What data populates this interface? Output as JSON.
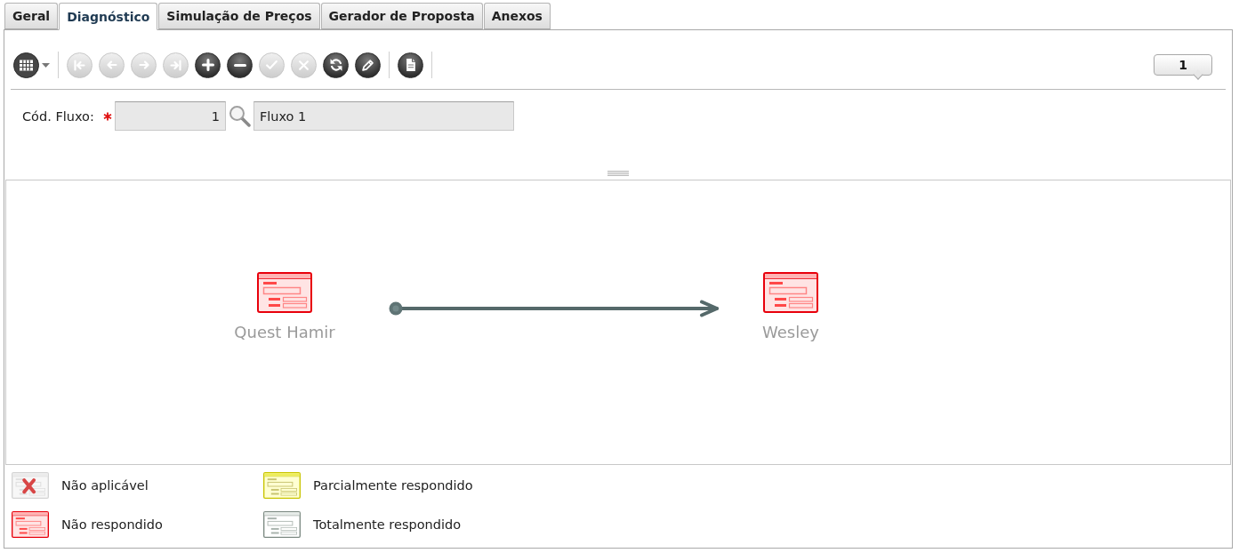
{
  "tabs": [
    {
      "label": "Geral",
      "selected": false
    },
    {
      "label": "Diagnóstico",
      "selected": true
    },
    {
      "label": "Simulação de Preços",
      "selected": false
    },
    {
      "label": "Gerador de Proposta",
      "selected": false
    },
    {
      "label": "Anexos",
      "selected": false
    }
  ],
  "toolbar": {
    "groups": [
      {
        "buttons": [
          {
            "kind": "grid_menu",
            "disabled": false
          }
        ]
      },
      {
        "buttons": [
          {
            "kind": "first",
            "disabled": true
          },
          {
            "kind": "previous",
            "disabled": true
          },
          {
            "kind": "next",
            "disabled": true
          },
          {
            "kind": "last",
            "disabled": true
          },
          {
            "kind": "add",
            "disabled": false
          },
          {
            "kind": "remove",
            "disabled": false
          },
          {
            "kind": "confirm",
            "disabled": true
          },
          {
            "kind": "cancel",
            "disabled": true
          },
          {
            "kind": "refresh",
            "disabled": false
          },
          {
            "kind": "edit",
            "disabled": false
          }
        ]
      },
      {
        "buttons": [
          {
            "kind": "report",
            "disabled": false
          }
        ]
      }
    ],
    "record_counter": "1"
  },
  "form": {
    "label": "Cód. Fluxo:",
    "required": true,
    "code": "1",
    "description": "Fluxo 1"
  },
  "diagram": {
    "nodes": [
      {
        "label": "Quest Hamir",
        "kind": "unanswered"
      },
      {
        "label": "Wesley",
        "kind": "unanswered"
      }
    ]
  },
  "legend": [
    {
      "label": "Não aplicável",
      "kind": "not_applicable"
    },
    {
      "label": "Parcialmente respondido",
      "kind": "partial"
    },
    {
      "label": "Não respondido",
      "kind": "unanswered"
    },
    {
      "label": "Totalmente respondido",
      "kind": "complete"
    }
  ]
}
